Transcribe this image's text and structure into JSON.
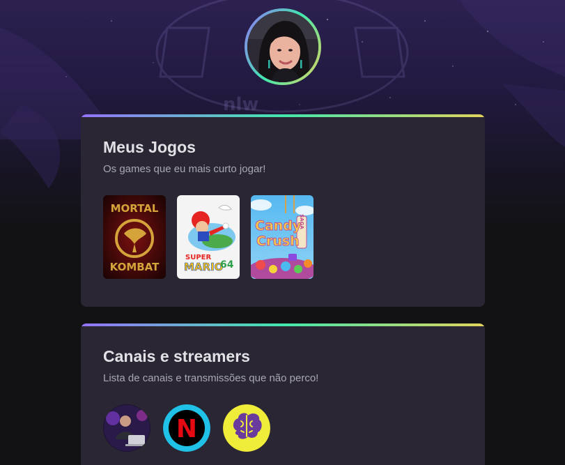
{
  "profile": {
    "avatar_icon": "user-photo-avatar"
  },
  "games_section": {
    "title": "Meus Jogos",
    "subtitle": "Os games que eu mais curto jogar!",
    "items": [
      {
        "name": "Mortal Kombat",
        "line1": "MORTAL",
        "line2": "KOMBAT",
        "icon": "mortal-kombat-cover"
      },
      {
        "name": "Super Mario 64",
        "line1": "SUPER",
        "line2": "MARIO",
        "line3": "64",
        "icon": "super-mario-64-cover"
      },
      {
        "name": "Candy Crush Saga",
        "line1": "Candy",
        "line2": "Crush",
        "line3": "SAGA",
        "icon": "candy-crush-cover"
      }
    ]
  },
  "channels_section": {
    "title": "Canais e streamers",
    "subtitle": "Lista de canais e transmissões que não perco!",
    "items": [
      {
        "icon": "streamer-avatar"
      },
      {
        "icon": "netflix-logo",
        "letter": "N"
      },
      {
        "icon": "brain-logo"
      }
    ]
  },
  "colors": {
    "background": "#121214",
    "card": "#2a2634",
    "title": "#e1e1e6",
    "subtitle": "#a8a8b3",
    "gradient": [
      "#9572fc",
      "#43e7ad",
      "#e2d45c"
    ]
  }
}
